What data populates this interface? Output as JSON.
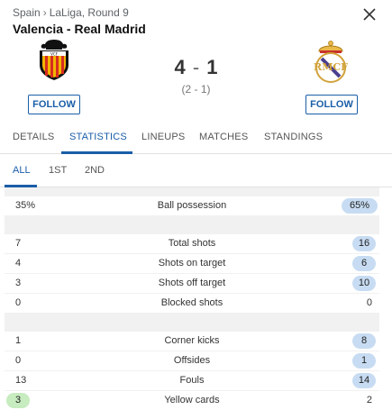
{
  "breadcrumb": {
    "country": "Spain",
    "separator": "›",
    "competition": "LaLiga, Round 9"
  },
  "match": {
    "title": "Valencia - Real Madrid",
    "home_score": "4",
    "away_score": "1",
    "score_separator": "-",
    "halftime": "(2 - 1)",
    "home_crest_icon": "valencia-crest-icon",
    "away_crest_icon": "real-madrid-crest-icon"
  },
  "buttons": {
    "follow_home": "FOLLOW",
    "follow_away": "FOLLOW",
    "close_icon": "close-icon"
  },
  "tabs": [
    "DETAILS",
    "STATISTICS",
    "LINEUPS",
    "MATCHES",
    "STANDINGS"
  ],
  "active_tab": "STATISTICS",
  "subtabs": [
    "ALL",
    "1ST",
    "2ND"
  ],
  "active_subtab": "ALL",
  "colors": {
    "accent": "#1a5ea8",
    "highlight_blue": "#c7dcf2",
    "highlight_green": "#c7ecbf",
    "divider": "#f1f1f1"
  },
  "stats": [
    {
      "left": "35%",
      "name": "Ball possession",
      "right": "65%",
      "winner": "right"
    },
    {
      "left": "7",
      "name": "Total shots",
      "right": "16",
      "winner": "right"
    },
    {
      "left": "4",
      "name": "Shots on target",
      "right": "6",
      "winner": "right"
    },
    {
      "left": "3",
      "name": "Shots off target",
      "right": "10",
      "winner": "right"
    },
    {
      "left": "0",
      "name": "Blocked shots",
      "right": "0",
      "winner": "none"
    },
    {
      "left": "1",
      "name": "Corner kicks",
      "right": "8",
      "winner": "right"
    },
    {
      "left": "0",
      "name": "Offsides",
      "right": "1",
      "winner": "right"
    },
    {
      "left": "13",
      "name": "Fouls",
      "right": "14",
      "winner": "right"
    },
    {
      "left": "3",
      "name": "Yellow cards",
      "right": "2",
      "winner": "left"
    }
  ]
}
